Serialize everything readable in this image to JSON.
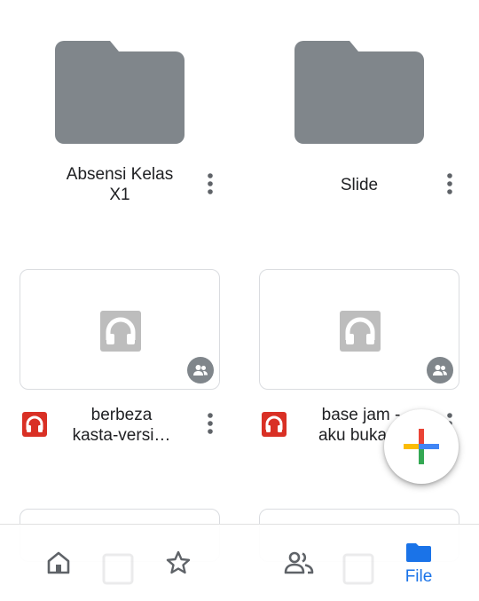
{
  "folders": [
    {
      "name_line1": "Absensi Kelas",
      "name_line2": "X1",
      "icon": "folder-icon"
    },
    {
      "name_line1": "Slide",
      "name_line2": "",
      "icon": "folder-icon"
    }
  ],
  "files": [
    {
      "name_line1": "berbeza",
      "name_line2": "kasta-versi…",
      "type_icon": "audio-file-icon",
      "shared": true
    },
    {
      "name_line1": "base jam -",
      "name_line2": "aku buka…",
      "type_icon": "audio-file-icon",
      "shared": true
    }
  ],
  "fab": {
    "icon": "google-plus-icon"
  },
  "bottom_nav": {
    "items": [
      {
        "id": "home",
        "icon": "home-icon",
        "label": ""
      },
      {
        "id": "starred",
        "icon": "star-icon",
        "label": ""
      },
      {
        "id": "shared",
        "icon": "people-icon",
        "label": ""
      },
      {
        "id": "files",
        "icon": "folder-icon",
        "label": "File",
        "active": true
      }
    ]
  },
  "colors": {
    "folder_gray": "#80868b",
    "audio_red": "#d93025",
    "active_blue": "#1a73e8",
    "icon_gray": "#5f6368",
    "thumb_icon_gray": "#bdbdbd",
    "border": "#dadce0"
  }
}
